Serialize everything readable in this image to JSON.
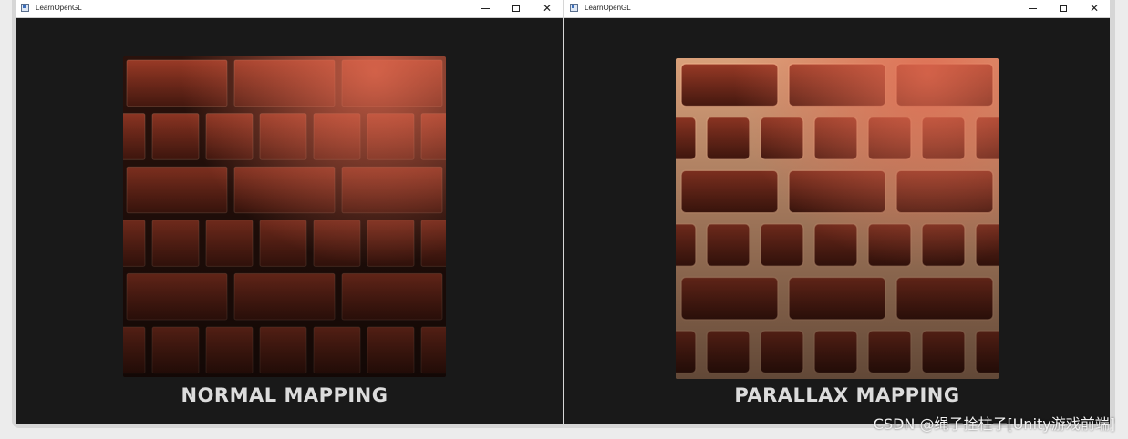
{
  "windows": [
    {
      "id": "left",
      "title": "LearnOpenGL",
      "caption": "NORMAL MAPPING",
      "controls": {
        "minimize": "—",
        "maximize": "☐",
        "close": "✕"
      }
    },
    {
      "id": "right",
      "title": "LearnOpenGL",
      "caption": "PARALLAX MAPPING",
      "controls": {
        "minimize": "—",
        "maximize": "☐",
        "close": "✕"
      }
    }
  ],
  "watermark": "CSDN @绳子拴柱子[Unity游戏前端]",
  "colors": {
    "viewport_bg": "#191919",
    "brick": "#7a2a1c",
    "mortar": "#2a120c",
    "highlight": "#e06a50"
  }
}
